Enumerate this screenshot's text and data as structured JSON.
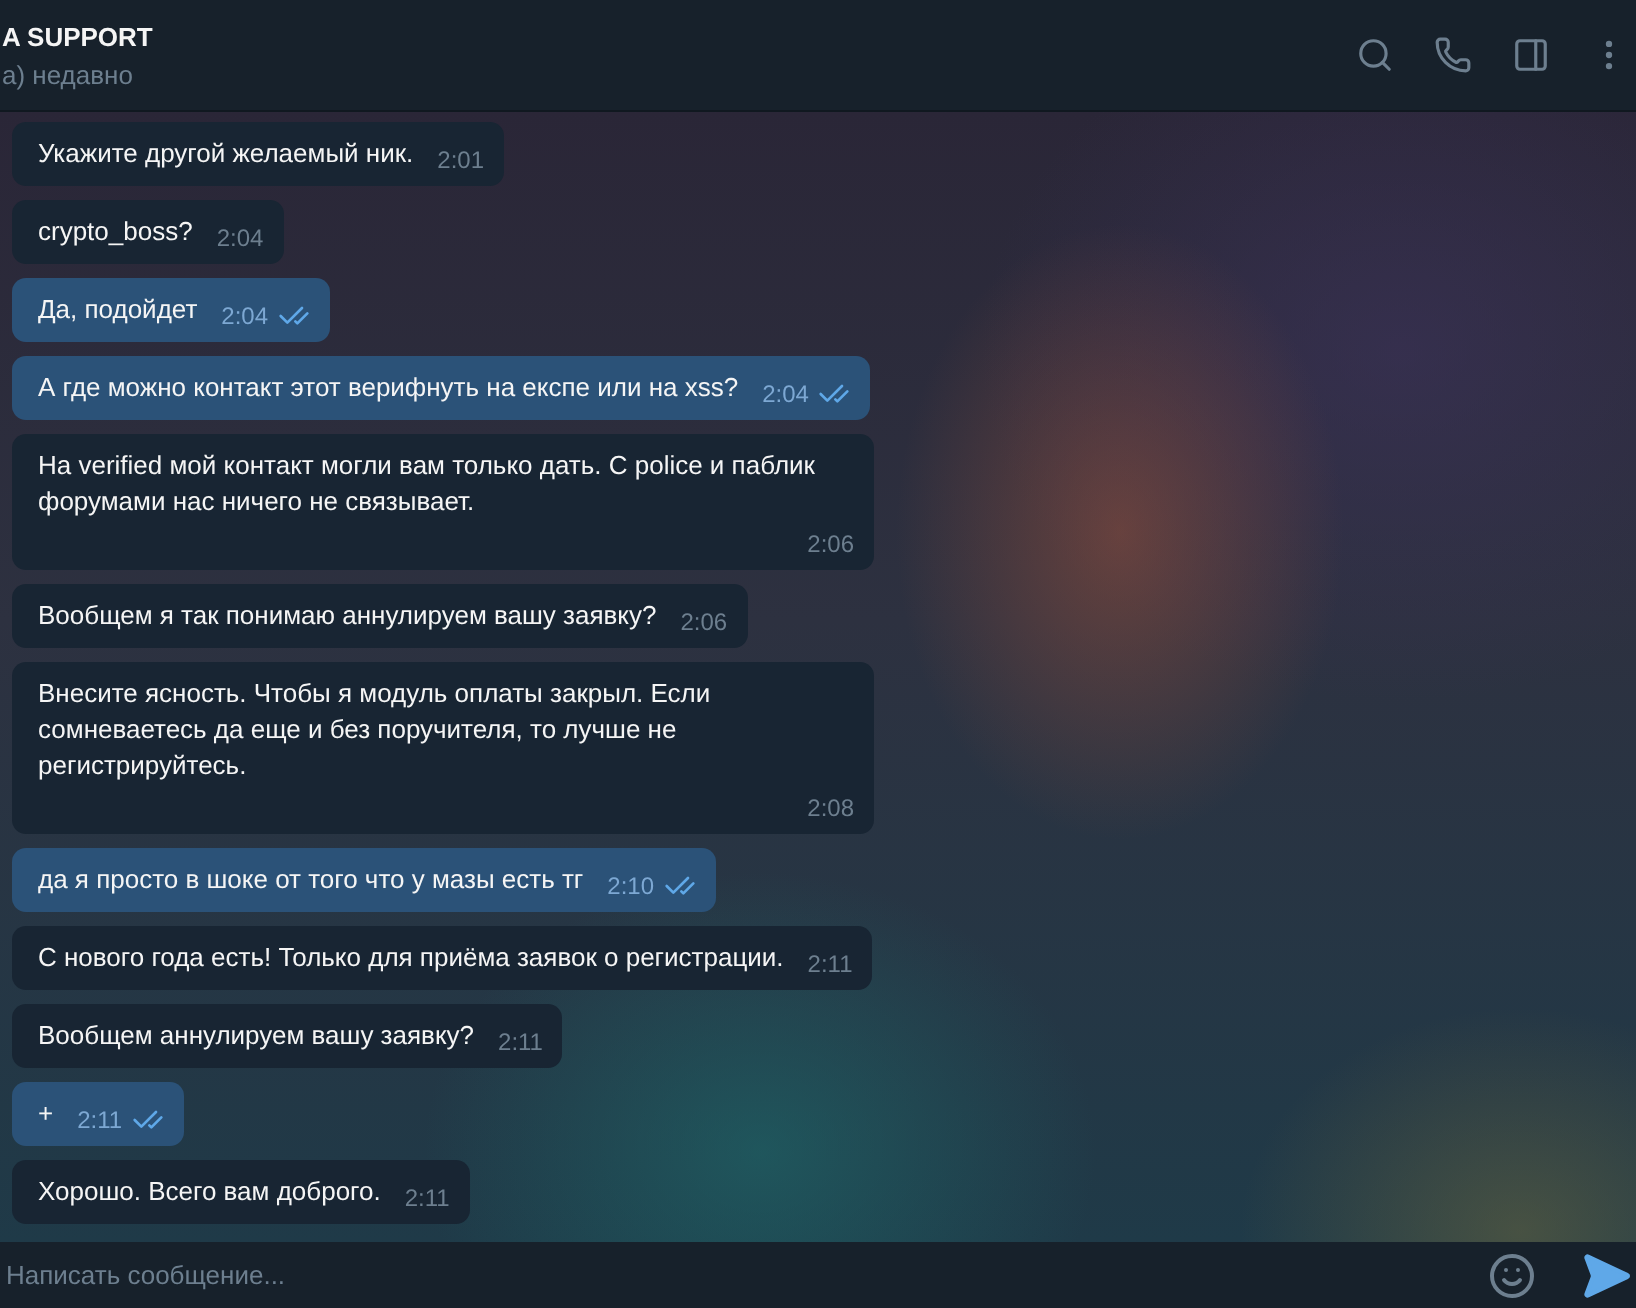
{
  "header": {
    "title": "A SUPPORT",
    "status": "а) недавно"
  },
  "messages": [
    {
      "kind": "incoming",
      "text": "Укажите другой желаемый ник.",
      "time": "2:01"
    },
    {
      "kind": "incoming",
      "text": "crypto_boss?",
      "time": "2:04"
    },
    {
      "kind": "outgoing",
      "text": "Да, подойдет",
      "time": "2:04",
      "read": true
    },
    {
      "kind": "outgoing",
      "text": "А где можно контакт этот верифнуть на експе или на xss?",
      "time": "2:04",
      "read": true
    },
    {
      "kind": "incoming",
      "text": "На verified мой контакт могли вам только дать. С police и паблик форумами нас ничего не связывает.",
      "time": "2:06"
    },
    {
      "kind": "incoming",
      "text": "Вообщем я так понимаю аннулируем вашу заявку?",
      "time": "2:06"
    },
    {
      "kind": "incoming",
      "text": "Внесите ясность. Чтобы я модуль оплаты закрыл. Если сомневаетесь да еще и без поручителя, то лучше не регистрируйтесь.",
      "time": "2:08"
    },
    {
      "kind": "outgoing",
      "text": "да я просто в шоке от того что у мазы есть тг",
      "time": "2:10",
      "read": true
    },
    {
      "kind": "incoming",
      "text": "С нового года есть! Только для приёма заявок о регистрации.",
      "time": "2:11"
    },
    {
      "kind": "incoming",
      "text": "Вообщем аннулируем вашу заявку?",
      "time": "2:11"
    },
    {
      "kind": "outgoing",
      "text": "+",
      "time": "2:11",
      "read": true
    },
    {
      "kind": "incoming",
      "text": "Хорошо. Всего вам доброго.",
      "time": "2:11"
    }
  ],
  "composer": {
    "placeholder": "Написать сообщение..."
  }
}
